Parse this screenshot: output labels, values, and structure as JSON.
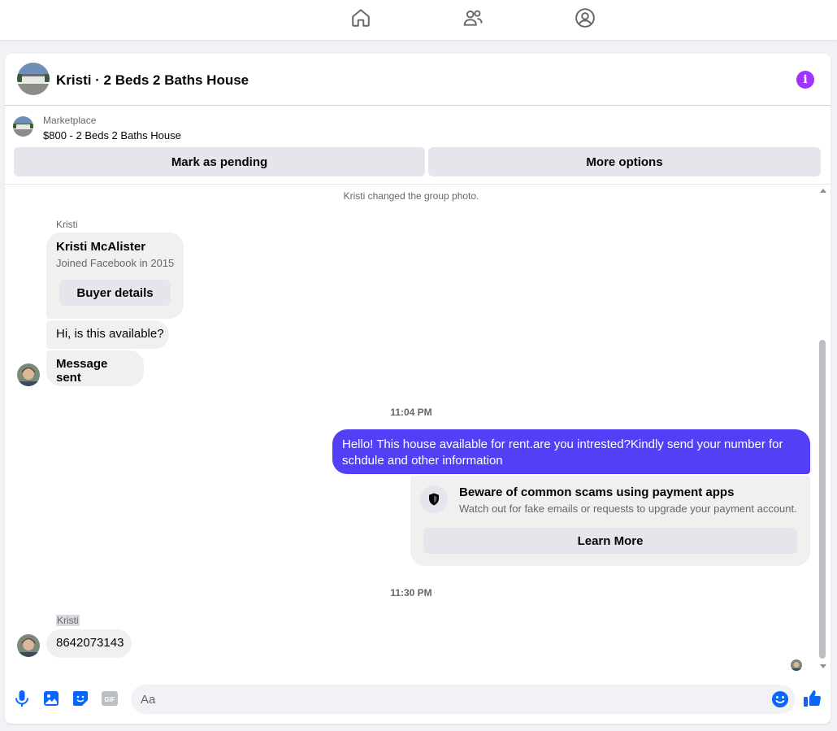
{
  "topnav": {
    "home_icon": "home-icon",
    "friends_icon": "friends-icon",
    "profile_icon": "profile-icon"
  },
  "header": {
    "title": "Kristi · 2 Beds 2 Baths House",
    "info_icon": "info-icon",
    "accent_color": "#a033ff"
  },
  "marketplace": {
    "label": "Marketplace",
    "listing": "$800 - 2 Beds 2 Baths House",
    "mark_pending": "Mark as pending",
    "more_options": "More options"
  },
  "conversation": {
    "system_note": "Kristi changed the group photo.",
    "buyer_sender": "Kristi",
    "buyer_card": {
      "name": "Kristi McAlister",
      "joined": "Joined Facebook in 2015",
      "button": "Buyer details"
    },
    "incoming_1": "Hi, is this available?",
    "incoming_2": "Message sent",
    "time_1": "11:04 PM",
    "outgoing_1": "Hello! This house available for rent.are you intrested?Kindly send your number for schdule and other information",
    "outgoing_color": "#533ff5",
    "scam_warning": {
      "title": "Beware of common scams using payment apps",
      "subtitle": "Watch out for fake emails or requests to upgrade your payment account.",
      "button": "Learn More"
    },
    "time_2": "11:30 PM",
    "sender_2": "Kristi",
    "incoming_3": "8642073143"
  },
  "composer": {
    "placeholder": "Aa",
    "icons": [
      "microphone-icon",
      "photo-icon",
      "sticker-icon",
      "gif-icon",
      "emoji-icon",
      "thumbs-up-icon"
    ],
    "gif_label": "GIF",
    "icon_color": "#0866ff"
  }
}
